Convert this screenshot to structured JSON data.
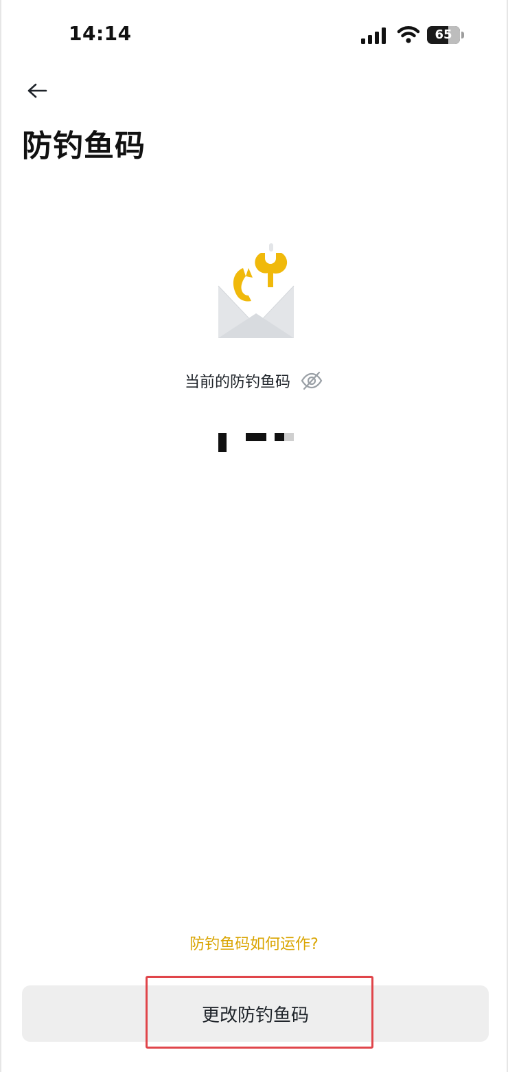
{
  "status_bar": {
    "time": "14:14",
    "battery_level": "65",
    "icons": [
      "signal-icon",
      "wifi-icon",
      "battery-icon"
    ]
  },
  "nav": {
    "back_icon": "arrow-left-icon"
  },
  "page": {
    "title": "防钓鱼码"
  },
  "illustration": {
    "icon": "envelope-fishhook-icon",
    "colors": {
      "envelope": "#e3e5e8",
      "envelope_fold": "#c9ccd1",
      "hook": "#f0b90b"
    }
  },
  "current_code": {
    "label": "当前的防钓鱼码",
    "visibility_icon": "eye-off-icon",
    "masked": true
  },
  "help_link": {
    "label": "防钓鱼码如何运作?",
    "color": "#d9a400"
  },
  "primary_action": {
    "label": "更改防钓鱼码",
    "highlighted": true,
    "highlight_color": "#e0454a"
  }
}
